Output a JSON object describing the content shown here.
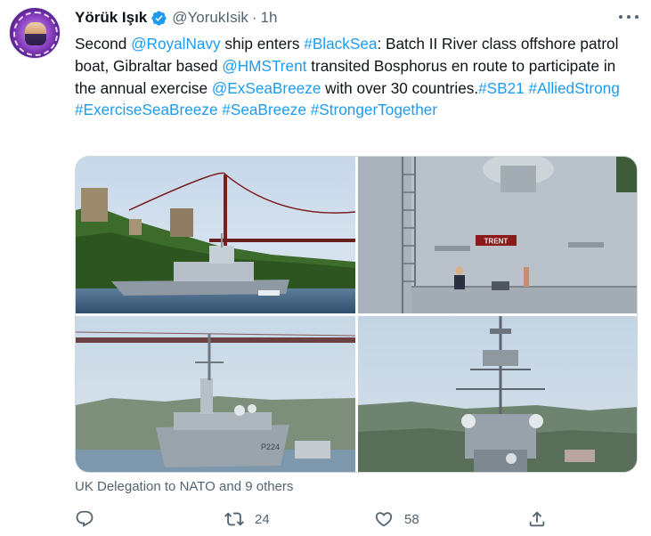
{
  "tweet": {
    "author": {
      "display_name": "Yörük Işık",
      "handle": "@YorukIsik",
      "verified": true,
      "avatar_icon": "avatar-badge-icon"
    },
    "separator": "·",
    "time": "1h",
    "more_icon": "more-horizontal-icon",
    "text": {
      "t1": "Second ",
      "m1": "@RoyalNavy",
      "t2": " ship enters ",
      "h1": "#BlackSea",
      "t3": ": Batch II River class offshore patrol boat, Gibraltar based ",
      "m2": "@HMSTrent",
      "t4": " transited Bosphorus en route to participate in the annual exercise ",
      "m3": "@ExSeaBreeze",
      "t5": " with over 30 countries.",
      "h2": "#SB21",
      "h3": "#AlliedStrong",
      "h4": "#ExerciseSeaBreeze",
      "h5": "#SeaBreeze",
      "h6": "#StrongerTogether"
    },
    "photos": [
      {
        "name": "photo-ship-bosphorus-bridge"
      },
      {
        "name": "photo-ship-deck-trent-nameplate",
        "nameplate": "TRENT"
      },
      {
        "name": "photo-ship-bow-under-bridge",
        "hull_number": "P224"
      },
      {
        "name": "photo-ship-mast-front-view"
      }
    ],
    "tagged": "UK Delegation to NATO and 9 others",
    "actions": {
      "reply": {
        "icon": "reply-icon",
        "count": ""
      },
      "retweet": {
        "icon": "retweet-icon",
        "count": "24"
      },
      "like": {
        "icon": "heart-icon",
        "count": "58"
      },
      "share": {
        "icon": "share-icon",
        "count": ""
      }
    }
  },
  "colors": {
    "link": "#1d9bf0",
    "text": "#0f1419",
    "secondary": "#536471",
    "border": "#cfd9de",
    "verified": "#1d9bf0"
  }
}
